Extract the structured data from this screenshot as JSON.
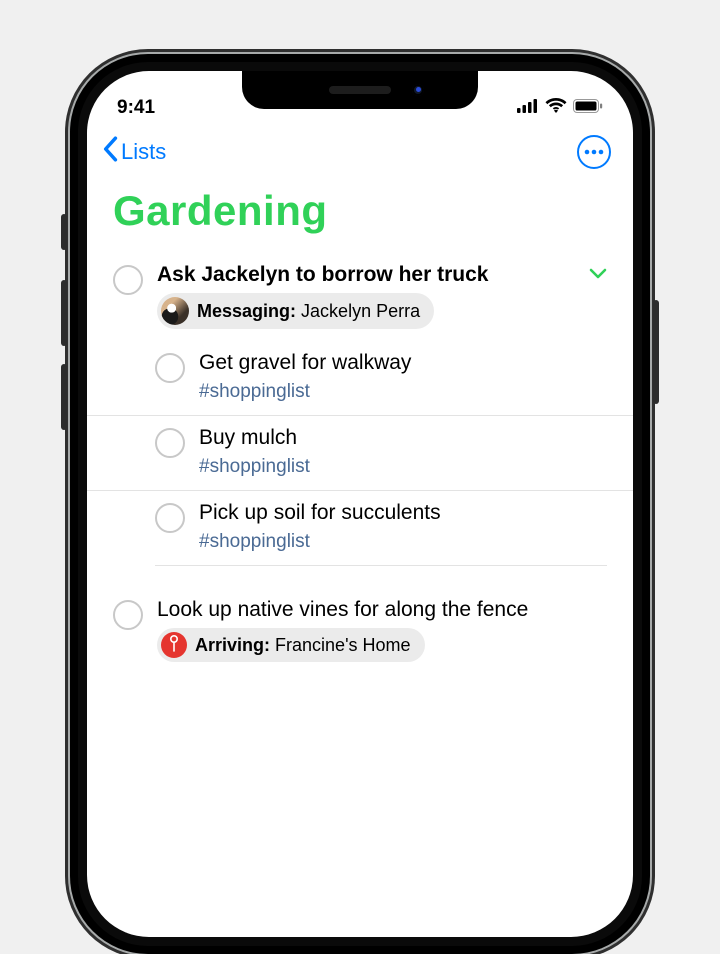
{
  "status": {
    "time": "9:41"
  },
  "nav": {
    "back_label": "Lists"
  },
  "title": "Gardening",
  "colors": {
    "accent": "#30d158",
    "link": "#007aff",
    "tag": "#4a6a94"
  },
  "reminders": [
    {
      "title": "Ask Jackelyn to borrow her truck",
      "expanded": true,
      "badge": {
        "type": "messaging",
        "label": "Messaging:",
        "value": "Jackelyn Perra"
      },
      "subtasks": [
        {
          "title": "Get gravel for walkway",
          "tag": "#shoppinglist"
        },
        {
          "title": "Buy mulch",
          "tag": "#shoppinglist"
        },
        {
          "title": "Pick up soil for succulents",
          "tag": "#shoppinglist"
        }
      ]
    },
    {
      "title": "Look up native vines for along the fence",
      "badge": {
        "type": "location",
        "label": "Arriving:",
        "value": "Francine's Home"
      }
    }
  ]
}
